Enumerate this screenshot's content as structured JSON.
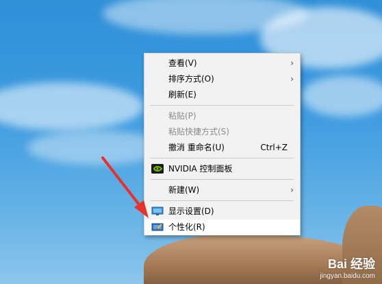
{
  "context_menu": {
    "items": [
      {
        "label": "查看(V)",
        "submenu": true
      },
      {
        "label": "排序方式(O)",
        "submenu": true
      },
      {
        "label": "刷新(E)"
      },
      {
        "label": "粘贴(P)",
        "disabled": true
      },
      {
        "label": "粘贴快捷方式(S)",
        "disabled": true
      },
      {
        "label": "撤消 重命名(U)",
        "shortcut": "Ctrl+Z"
      },
      {
        "label": "NVIDIA 控制面板",
        "icon": "nvidia-icon"
      },
      {
        "label": "新建(W)",
        "submenu": true
      },
      {
        "label": "显示设置(D)",
        "icon": "display-settings-icon"
      },
      {
        "label": "个性化(R)",
        "icon": "personalize-icon",
        "highlighted": true
      }
    ]
  },
  "watermark": {
    "brand": "Bai 经验",
    "url": "jingyan.baidu.com"
  },
  "colors": {
    "menu_bg": "#f2f2f2",
    "highlight": "#ffffff",
    "disabled_text": "#8a8a8a",
    "annotation_arrow": "#e8312b"
  }
}
